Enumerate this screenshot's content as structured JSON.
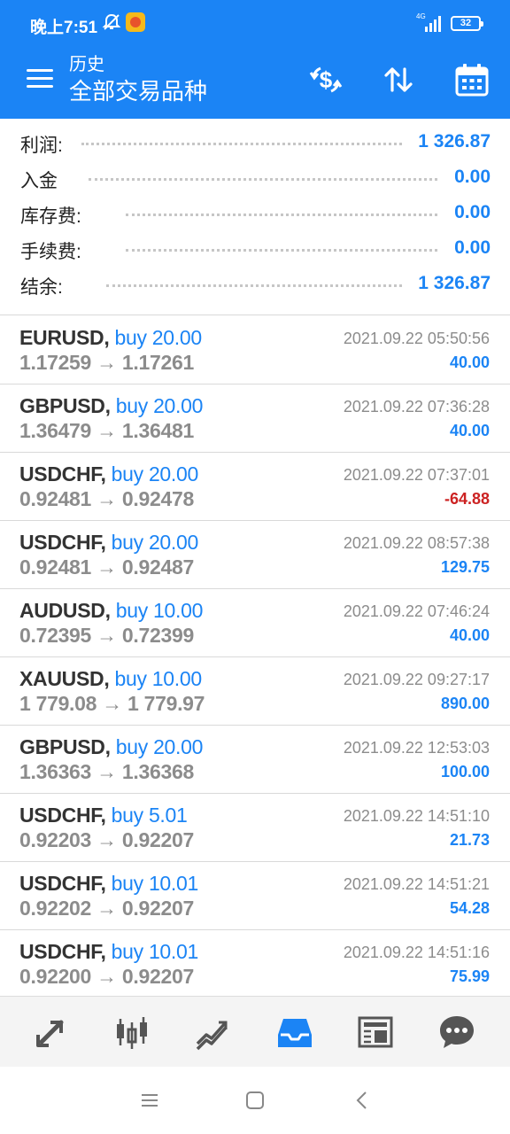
{
  "status_bar": {
    "time": "晚上7:51",
    "network": "4G",
    "battery": "32"
  },
  "header": {
    "subtitle": "历史",
    "title": "全部交易品种",
    "icons": [
      "menu-icon",
      "dollar-refresh-icon",
      "sort-icon",
      "calendar-icon"
    ]
  },
  "summary": [
    {
      "label": "利润:",
      "value": "1 326.87"
    },
    {
      "label": "入金",
      "value": "0.00"
    },
    {
      "label": "库存费:",
      "value": "0.00"
    },
    {
      "label": "手续费:",
      "value": "0.00"
    },
    {
      "label": "结余:",
      "value": "1 326.87"
    }
  ],
  "trades": [
    {
      "symbol": "EURUSD,",
      "side": "buy 20.00",
      "prices": "1.17259 → 1.17261",
      "time": "2021.09.22 05:50:56",
      "profit": "40.00",
      "negative": false
    },
    {
      "symbol": "GBPUSD,",
      "side": "buy 20.00",
      "prices": "1.36479 → 1.36481",
      "time": "2021.09.22 07:36:28",
      "profit": "40.00",
      "negative": false
    },
    {
      "symbol": "USDCHF,",
      "side": "buy 20.00",
      "prices": "0.92481 → 0.92478",
      "time": "2021.09.22 07:37:01",
      "profit": "-64.88",
      "negative": true
    },
    {
      "symbol": "USDCHF,",
      "side": "buy 20.00",
      "prices": "0.92481 → 0.92487",
      "time": "2021.09.22 08:57:38",
      "profit": "129.75",
      "negative": false
    },
    {
      "symbol": "AUDUSD,",
      "side": "buy 10.00",
      "prices": "0.72395 → 0.72399",
      "time": "2021.09.22 07:46:24",
      "profit": "40.00",
      "negative": false
    },
    {
      "symbol": "XAUUSD,",
      "side": "buy 10.00",
      "prices": "1 779.08 → 1 779.97",
      "time": "2021.09.22 09:27:17",
      "profit": "890.00",
      "negative": false
    },
    {
      "symbol": "GBPUSD,",
      "side": "buy 20.00",
      "prices": "1.36363 → 1.36368",
      "time": "2021.09.22 12:53:03",
      "profit": "100.00",
      "negative": false
    },
    {
      "symbol": "USDCHF,",
      "side": "buy 5.01",
      "prices": "0.92203 → 0.92207",
      "time": "2021.09.22 14:51:10",
      "profit": "21.73",
      "negative": false
    },
    {
      "symbol": "USDCHF,",
      "side": "buy 10.01",
      "prices": "0.92202 → 0.92207",
      "time": "2021.09.22 14:51:21",
      "profit": "54.28",
      "negative": false
    },
    {
      "symbol": "USDCHF,",
      "side": "buy 10.01",
      "prices": "0.92200 → 0.92207",
      "time": "2021.09.22 14:51:16",
      "profit": "75.99",
      "negative": false
    }
  ],
  "bottom_nav": {
    "items": [
      "quotes-icon",
      "chart-icon",
      "trade-icon",
      "history-icon",
      "news-icon",
      "chat-icon"
    ],
    "active": "history-icon"
  },
  "colors": {
    "accent": "#1b84f5",
    "negative": "#cc2222",
    "muted": "#8c8c8c",
    "nav_inactive": "#555555"
  }
}
